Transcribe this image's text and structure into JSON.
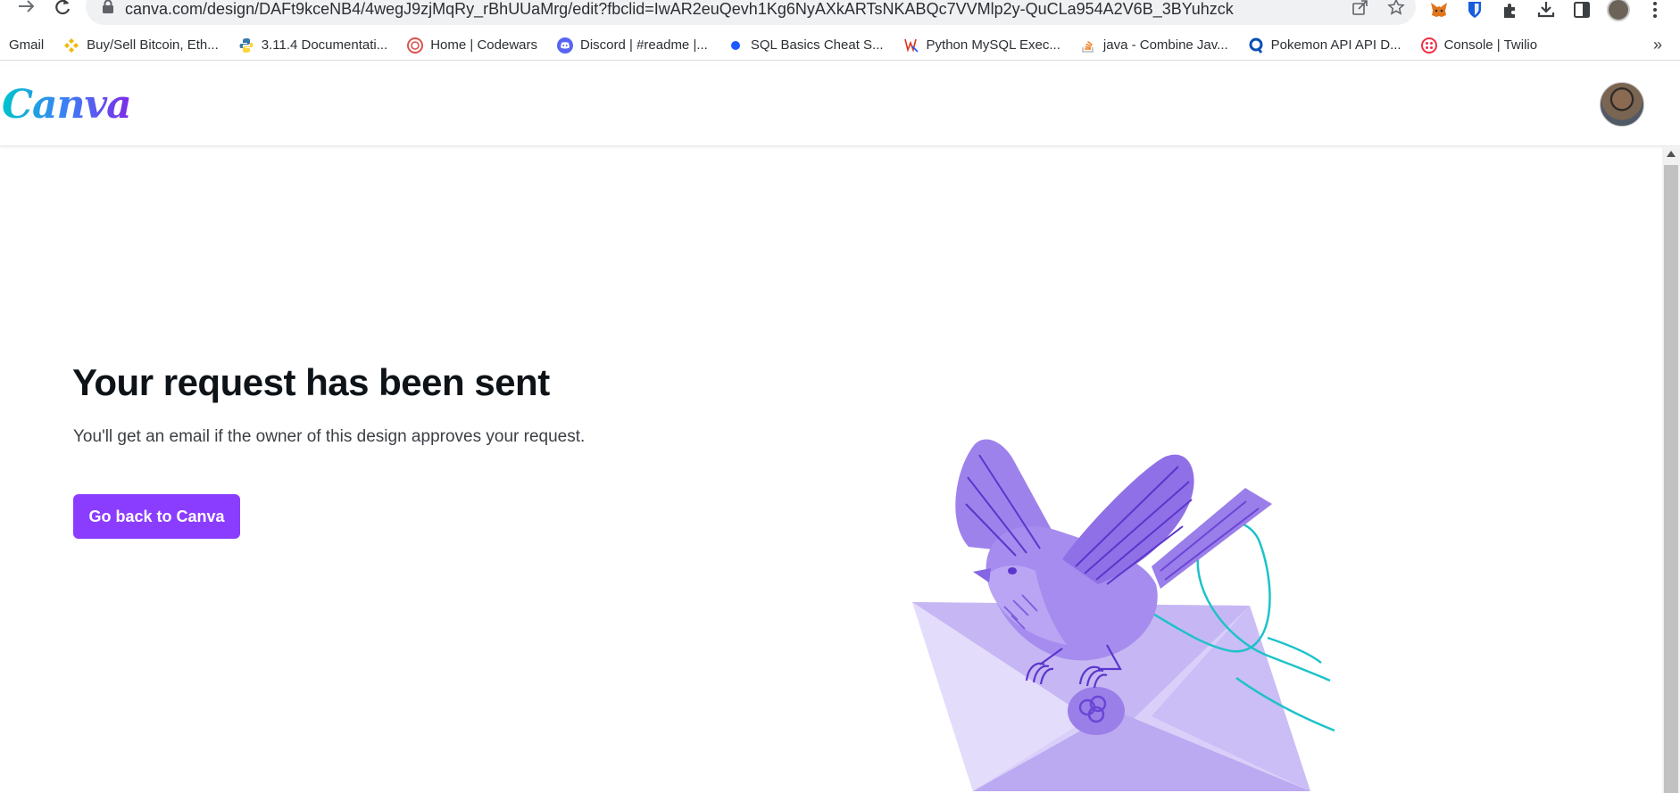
{
  "browser": {
    "url": "canva.com/design/DAFt9kceNB4/4wegJ9zjMqRy_rBhUUaMrg/edit?fbclid=IwAR2euQevh1Kg6NyAXkARTsNKABQc7VVMlp2y-QuCLa954A2V6B_3BYuhzck",
    "icons": [
      "forward-icon",
      "reload-icon",
      "lock-icon",
      "share-icon",
      "star-icon",
      "metamask-icon",
      "bitwarden-icon",
      "extensions-icon",
      "download-icon",
      "sidepanel-icon",
      "menu-icon"
    ]
  },
  "bookmarks": [
    {
      "label": "Gmail",
      "icon": "gmail-icon",
      "color": "#4285f4"
    },
    {
      "label": "Buy/Sell Bitcoin, Eth...",
      "icon": "binance-icon",
      "color": "#f0b90b"
    },
    {
      "label": "3.11.4 Documentati...",
      "icon": "python-icon",
      "color": "#3776ab"
    },
    {
      "label": "Home | Codewars",
      "icon": "codewars-icon",
      "color": "#b1361e"
    },
    {
      "label": "Discord | #readme |...",
      "icon": "discord-icon",
      "color": "#5865f2"
    },
    {
      "label": "SQL Basics Cheat S...",
      "icon": "dot-icon",
      "color": "#1a5cff"
    },
    {
      "label": "Python MySQL Exec...",
      "icon": "w3-icon",
      "color": "#e0301e"
    },
    {
      "label": "java - Combine Jav...",
      "icon": "stackoverflow-icon",
      "color": "#f48024"
    },
    {
      "label": "Pokemon API API D...",
      "icon": "pokeapi-icon",
      "color": "#0a4fb5"
    },
    {
      "label": "Console | Twilio",
      "icon": "twilio-icon",
      "color": "#f22f46"
    }
  ],
  "header": {
    "logo": "Canva"
  },
  "main": {
    "title": "Your request has been sent",
    "subtitle": "You'll get an email if the owner of this design approves your request.",
    "button_label": "Go back to Canva"
  },
  "colors": {
    "brand_purple": "#8b3dff",
    "bird_purple": "#a58cee",
    "envelope_light": "#d6cbf7",
    "ribbon_teal": "#1ec2c9"
  }
}
